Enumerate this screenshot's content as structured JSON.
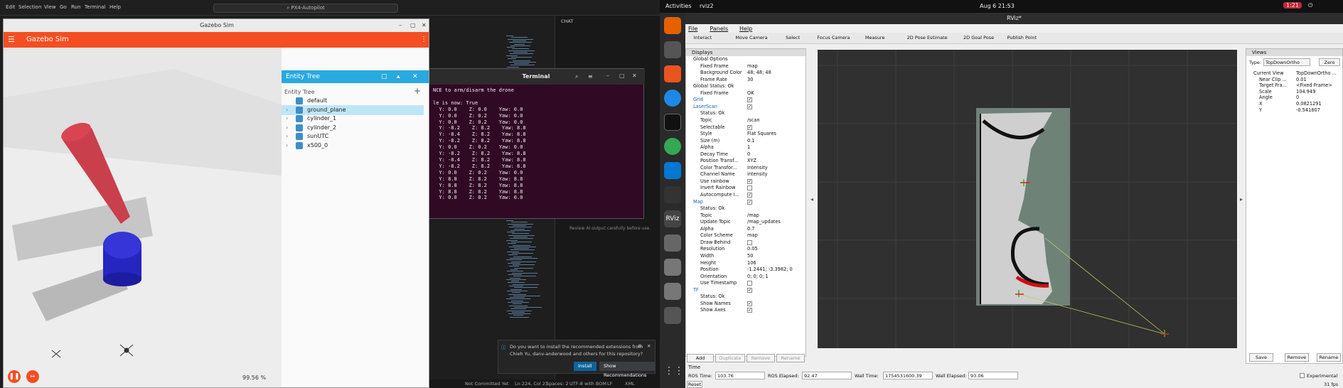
{
  "vscode": {
    "menu": [
      "Edit",
      "Selection",
      "View",
      "Go",
      "Run",
      "Terminal",
      "Help"
    ],
    "search": "PX4-Autopilot",
    "chat_label": "CHAT",
    "chat_note": "Review AI output carefully before use.",
    "notification": {
      "text1": "Do you want to install the recommended extensions from",
      "text2": "Chieh Yu, danv-anderwood and others for this repository?",
      "install": "Install",
      "show": "Show Recommendations"
    },
    "status": {
      "commit": "Not Committed Yet",
      "pos": "Ln 224, Col 21",
      "spaces": "Spaces: 2",
      "enc": "UTF-8 with BOM",
      "eol": "LF",
      "lang": "XML"
    }
  },
  "gazebo": {
    "window_title": "Gazebo Sim",
    "app_title": "Gazebo Sim",
    "panel_title": "Entity Tree",
    "tree_label": "Entity Tree",
    "entities": [
      "default",
      "ground_plane",
      "cylinder_1",
      "cylinder_2",
      "sunUTC",
      "x500_0"
    ],
    "selected": "ground_plane",
    "rtf": "99.56 %"
  },
  "terminal": {
    "title": "Terminal",
    "lines": [
      "NCE to arm/disarm the drone",
      "",
      "le is now: True",
      "  Y: 0.0    Z: 0.0    Yaw: 0.0",
      "  Y: 0.0    Z: 0.2    Yaw: 0.0",
      "  Y: 0.0    Z: 0.2    Yaw: 0.0",
      "  Y: -8.2    Z: 8.2    Yaw: 8.8",
      "  Y: -8.4    Z: 8.2    Yaw: 8.8",
      "  Y: -8.2    Z: 8.2    Yaw: 8.8",
      "  Y: 0.0    Z: 0.2    Yaw: 0.0",
      "  Y: -8.2    Z: 8.2    Yaw: 8.8",
      "  Y: -8.4    Z: 8.2    Yaw: 8.8",
      "  Y: -8.2    Z: 8.2    Yaw: 8.8",
      "  Y: 0.0    Z: 0.2    Yaw: 0.0",
      "  Y: 8.8    Z: 8.2    Yaw: 8.8",
      "  Y: 8.8    Z: 8.2    Yaw: 8.8",
      "  Y: 8.8    Z: 8.2    Yaw: 8.8",
      "  Y: 0.0    Z: 0.2    Yaw: 0.0"
    ]
  },
  "desktop": {
    "activities": "Activities",
    "app": "rviz2",
    "clock": "Aug 6  21:53",
    "indicator": "1:21"
  },
  "rviz": {
    "title": "RViz*",
    "menu": [
      "File",
      "Panels",
      "Help"
    ],
    "tools": [
      "Interact",
      "Move Camera",
      "Select",
      "Focus Camera",
      "Measure",
      "2D Pose Estimate",
      "2D Goal Pose",
      "Publish Point"
    ],
    "displays_title": "Displays",
    "rows": [
      {
        "i": 0,
        "label": "Global Options",
        "value": ""
      },
      {
        "i": 1,
        "label": "Fixed Frame",
        "value": "map"
      },
      {
        "i": 1,
        "label": "Background Color",
        "value": "48; 48; 48"
      },
      {
        "i": 1,
        "label": "Frame Rate",
        "value": "30"
      },
      {
        "i": 0,
        "label": "Global Status: Ok",
        "value": ""
      },
      {
        "i": 1,
        "label": "Fixed Frame",
        "value": "OK"
      },
      {
        "i": 0,
        "label": "Grid",
        "value": "",
        "blue": true
      },
      {
        "i": 0,
        "label": "LaserScan",
        "value": "",
        "blue": true
      },
      {
        "i": 1,
        "label": "Status: Ok",
        "value": ""
      },
      {
        "i": 1,
        "label": "Topic",
        "value": "/scan"
      },
      {
        "i": 1,
        "label": "Selectable",
        "value": ""
      },
      {
        "i": 1,
        "label": "Style",
        "value": "Flat Squares"
      },
      {
        "i": 1,
        "label": "Size (m)",
        "value": "0.1"
      },
      {
        "i": 1,
        "label": "Alpha",
        "value": "1"
      },
      {
        "i": 1,
        "label": "Decay Time",
        "value": "0"
      },
      {
        "i": 1,
        "label": "Position Transf...",
        "value": "XYZ"
      },
      {
        "i": 1,
        "label": "Color Transfor...",
        "value": "Intensity"
      },
      {
        "i": 1,
        "label": "Channel Name",
        "value": "intensity"
      },
      {
        "i": 1,
        "label": "Use rainbow",
        "value": ""
      },
      {
        "i": 1,
        "label": "Invert Rainbow",
        "value": ""
      },
      {
        "i": 1,
        "label": "Autocompute I...",
        "value": ""
      },
      {
        "i": 0,
        "label": "Map",
        "value": "",
        "blue": true
      },
      {
        "i": 1,
        "label": "Status: Ok",
        "value": ""
      },
      {
        "i": 1,
        "label": "Topic",
        "value": "/map"
      },
      {
        "i": 1,
        "label": "Update Topic",
        "value": "/map_updates"
      },
      {
        "i": 1,
        "label": "Alpha",
        "value": "0.7"
      },
      {
        "i": 1,
        "label": "Color Scheme",
        "value": "map"
      },
      {
        "i": 1,
        "label": "Draw Behind",
        "value": ""
      },
      {
        "i": 1,
        "label": "Resolution",
        "value": "0.05"
      },
      {
        "i": 1,
        "label": "Width",
        "value": "50"
      },
      {
        "i": 1,
        "label": "Height",
        "value": "106"
      },
      {
        "i": 1,
        "label": "Position",
        "value": "-1.2441; -3.3982; 0"
      },
      {
        "i": 1,
        "label": "Orientation",
        "value": "0; 0; 0; 1"
      },
      {
        "i": 1,
        "label": "Use Timestamp",
        "value": ""
      },
      {
        "i": 0,
        "label": "TF",
        "value": "",
        "blue": true
      },
      {
        "i": 1,
        "label": "Status: Ok",
        "value": ""
      },
      {
        "i": 1,
        "label": "Show Names",
        "value": ""
      },
      {
        "i": 1,
        "label": "Show Axes",
        "value": ""
      }
    ],
    "buttons": [
      "Add",
      "Duplicate",
      "Remove",
      "Rename"
    ],
    "views": {
      "title": "Views",
      "type_label": "Type:",
      "type_value": "TopDownOrtho",
      "zero": "Zero",
      "rows": [
        {
          "label": "Current View",
          "value": "TopDownOrtho ..."
        },
        {
          "label": "Near Clip ...",
          "value": "0.01"
        },
        {
          "label": "Target Fra...",
          "value": "<Fixed Frame>"
        },
        {
          "label": "Scale",
          "value": "104.949"
        },
        {
          "label": "Angle",
          "value": "0"
        },
        {
          "label": "X",
          "value": "0.0821291"
        },
        {
          "label": "Y",
          "value": "-0.541807"
        }
      ],
      "buttons": [
        "Save",
        "Remove",
        "Rename"
      ]
    },
    "time": {
      "title": "Time",
      "ros_time_label": "ROS Time:",
      "ros_time": "103.76",
      "ros_elapsed_label": "ROS Elapsed:",
      "ros_elapsed": "92.47",
      "wall_time_label": "Wall Time:",
      "wall_time": "1754531600.39",
      "wall_elapsed_label": "Wall Elapsed:",
      "wall_elapsed": "93.06",
      "experimental": "Experimental",
      "reset": "Reset",
      "fps": "31 fps"
    }
  }
}
